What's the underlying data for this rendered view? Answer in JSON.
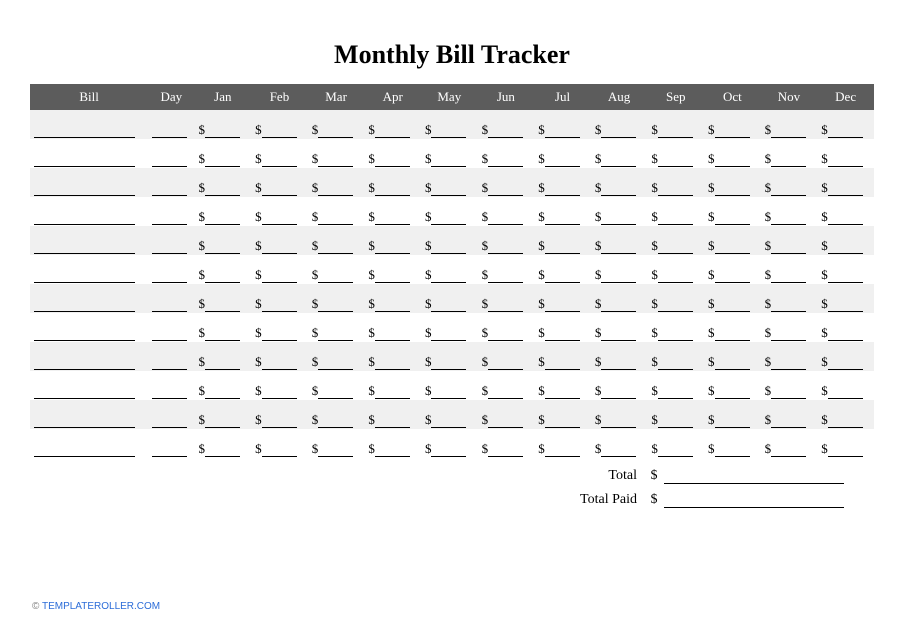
{
  "title": "Monthly Bill Tracker",
  "currency_symbol": "$",
  "headers": {
    "bill": "Bill",
    "day": "Day",
    "months": [
      "Jan",
      "Feb",
      "Mar",
      "Apr",
      "May",
      "Jun",
      "Jul",
      "Aug",
      "Sep",
      "Oct",
      "Nov",
      "Dec"
    ]
  },
  "row_count": 12,
  "totals": {
    "total_label": "Total",
    "total_paid_label": "Total Paid"
  },
  "footer": {
    "prefix": "© ",
    "link": "TEMPLATEROLLER.COM"
  }
}
